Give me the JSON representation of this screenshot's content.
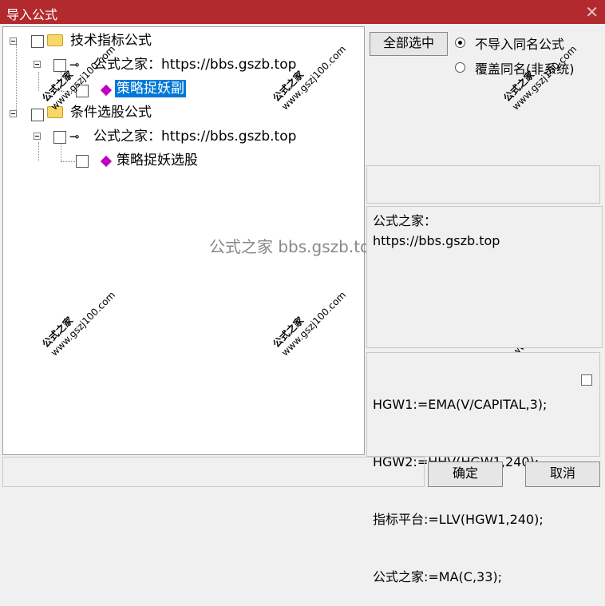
{
  "window": {
    "title": "导入公式",
    "close_glyph": "✕"
  },
  "tree": {
    "node1": {
      "label": "技术指标公式"
    },
    "node1_child": {
      "label": "公式之家：https://bbs.gszb.top"
    },
    "node1_leaf": {
      "label": "策略捉妖副"
    },
    "node2": {
      "label": "条件选股公式"
    },
    "node2_child": {
      "label": "公式之家：https://bbs.gszb.top"
    },
    "node2_leaf": {
      "label": "策略捉妖选股"
    }
  },
  "watermark": {
    "text": "公式之家",
    "site": "www.gszj100.com",
    "center": "公式之家 bbs.gszb.top"
  },
  "options": {
    "select_all": "全部选中",
    "radio_no_import": "不导入同名公式",
    "radio_overwrite": "覆盖同名(非系统)"
  },
  "info": {
    "line1": "公式之家：",
    "line2": "https://bbs.gszb.top"
  },
  "code": {
    "line1": "HGW1:=EMA(V/CAPITAL,3);",
    "line2": "HGW2:=HHV(HGW1,240);",
    "line3": "指标平台:=LLV(HGW1,240);",
    "line4": "公式之家:=MA(C,33);"
  },
  "buttons": {
    "ok": "确定",
    "cancel": "取消"
  },
  "icons": {
    "folder": "folder-icon",
    "key": "key-icon",
    "gem": "gem-icon"
  },
  "colors": {
    "titlebar": "#b22a2e",
    "selection": "#0078d7"
  }
}
